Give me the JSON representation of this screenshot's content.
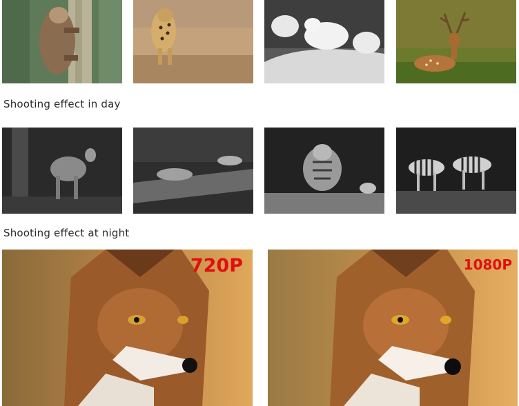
{
  "day_row": {
    "caption": "Shooting effect in day",
    "photos": [
      {
        "icon": "sloth-photo"
      },
      {
        "icon": "leopard-photo"
      },
      {
        "icon": "white-wolves-photo"
      },
      {
        "icon": "deer-photo"
      }
    ]
  },
  "night_row": {
    "caption": "Shooting effect at night",
    "photos": [
      {
        "icon": "night-antelope-photo"
      },
      {
        "icon": "night-lion-photo"
      },
      {
        "icon": "night-tiger-photo"
      },
      {
        "icon": "night-zebras-photo"
      }
    ]
  },
  "resolution_compare": [
    {
      "label": "720P",
      "icon": "fox-photo-720p"
    },
    {
      "label": "1080P",
      "icon": "fox-photo-1080p"
    }
  ],
  "colors": {
    "label_red": "#e01010",
    "caption_text": "#2b2b2b"
  }
}
